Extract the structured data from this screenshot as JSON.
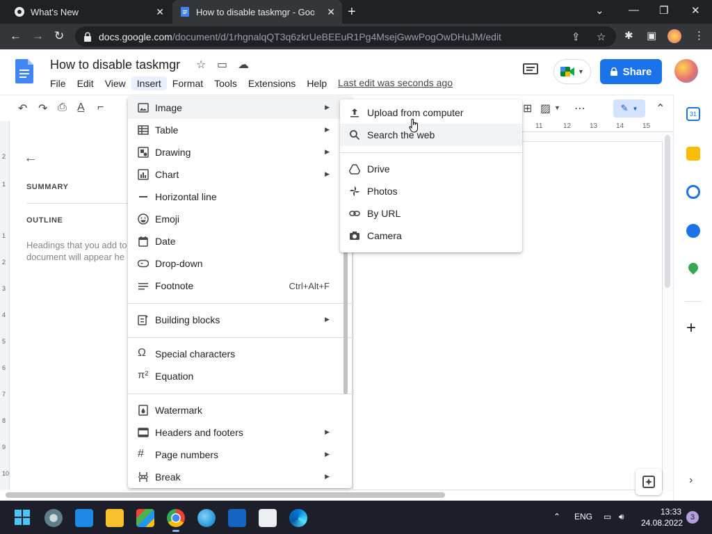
{
  "browser": {
    "tabs": [
      {
        "title": "What's New"
      },
      {
        "title": "How to disable taskmgr - Google Docs"
      }
    ],
    "url_host": "docs.google.com",
    "url_path": "/document/d/1rhgnalqQT3q6zkrUeBEEuR1Pg4MsejGwwPogOwDHuJM/edit"
  },
  "docs": {
    "title": "How to disable taskmgr",
    "menu": [
      "File",
      "Edit",
      "View",
      "Insert",
      "Format",
      "Tools",
      "Extensions",
      "Help"
    ],
    "last_edit": "Last edit was seconds ago",
    "share_label": "Share"
  },
  "outline_panel": {
    "summary_label": "SUMMARY",
    "outline_label": "OUTLINE",
    "hint_line1": "Headings that you add to",
    "hint_line2": "document will appear he"
  },
  "ruler": {
    "h_ticks": [
      "11",
      "12",
      "13",
      "14",
      "15"
    ],
    "v_ticks": [
      "2",
      "1",
      "1",
      "2",
      "3",
      "4",
      "5",
      "6",
      "7",
      "8",
      "9",
      "10"
    ]
  },
  "insert_menu": {
    "items": [
      {
        "label": "Image",
        "icon": "image-icon",
        "submenu": true
      },
      {
        "label": "Table",
        "icon": "table-icon",
        "submenu": true
      },
      {
        "label": "Drawing",
        "icon": "drawing-icon",
        "submenu": true
      },
      {
        "label": "Chart",
        "icon": "chart-icon",
        "submenu": true
      },
      {
        "label": "Horizontal line",
        "icon": "horizontal-line-icon",
        "submenu": false
      },
      {
        "label": "Emoji",
        "icon": "emoji-icon",
        "submenu": false
      },
      {
        "label": "Date",
        "icon": "calendar-icon",
        "submenu": false
      },
      {
        "label": "Drop-down",
        "icon": "dropdown-chip-icon",
        "submenu": false
      },
      {
        "label": "Footnote",
        "icon": "footnote-icon",
        "submenu": false,
        "shortcut": "Ctrl+Alt+F"
      },
      {
        "label": "Building blocks",
        "icon": "building-blocks-icon",
        "submenu": true
      },
      {
        "label": "Special characters",
        "icon": "omega-icon",
        "submenu": false
      },
      {
        "label": "Equation",
        "icon": "pi-icon",
        "submenu": false
      },
      {
        "label": "Watermark",
        "icon": "watermark-icon",
        "submenu": false
      },
      {
        "label": "Headers and footers",
        "icon": "header-footer-icon",
        "submenu": true
      },
      {
        "label": "Page numbers",
        "icon": "hash-icon",
        "submenu": true
      },
      {
        "label": "Break",
        "icon": "break-icon",
        "submenu": true
      }
    ]
  },
  "image_submenu": {
    "items": [
      {
        "label": "Upload from computer",
        "icon": "upload-icon"
      },
      {
        "label": "Search the web",
        "icon": "search-icon"
      },
      {
        "label": "Drive",
        "icon": "drive-icon"
      },
      {
        "label": "Photos",
        "icon": "photos-icon"
      },
      {
        "label": "By URL",
        "icon": "link-icon"
      },
      {
        "label": "Camera",
        "icon": "camera-icon"
      }
    ]
  },
  "taskbar": {
    "lang": "ENG",
    "time": "13:33",
    "date": "24.08.2022",
    "notifications": "3"
  },
  "colors": {
    "accent": "#1a73e8",
    "menu_highlight": "#f1f3f4",
    "tab_bg": "#202124"
  }
}
